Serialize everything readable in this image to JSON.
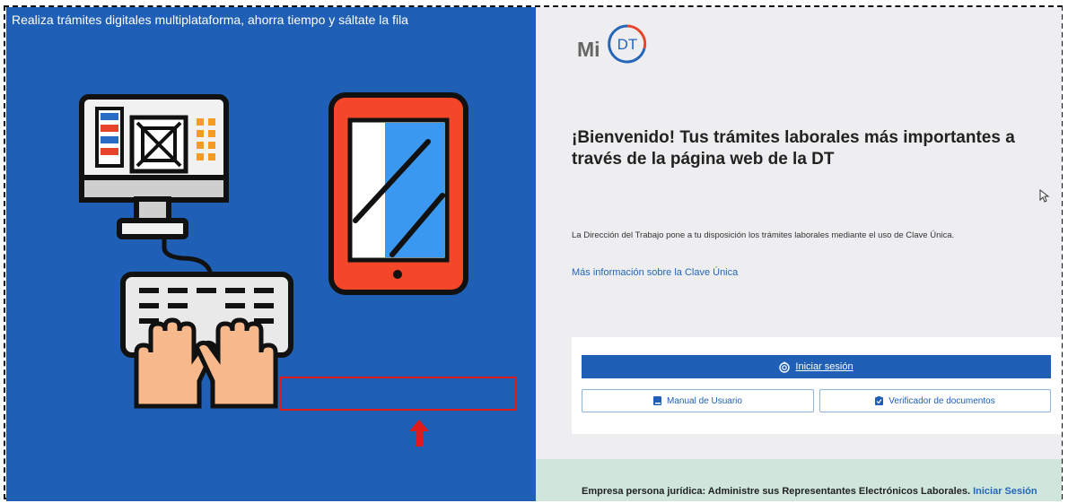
{
  "left_panel": {
    "tagline": "Realiza trámites digitales multiplataforma, ahorra tiempo y sáltate la fila",
    "background": "#1f5fb5"
  },
  "logo": {
    "mi": "Mi",
    "dt": "DT"
  },
  "welcome": {
    "title": "¡Bienvenido! Tus trámites laborales más importantes a través de la página web de la DT"
  },
  "description": "La Dirección del Trabajo pone a tu disposición los trámites laborales mediante el uso de Clave Única.",
  "more_info_link": "Más información sobre la Clave Única",
  "buttons": {
    "login": "Iniciar sesión",
    "manual": "Manual de Usuario",
    "verifier": "Verificador de documentos"
  },
  "footer": {
    "text": "Empresa persona jurídica: Administre sus Representantes Electrónicos Laborales.",
    "link": "Iniciar Sesión"
  },
  "icons": [
    "desktop-computer-icon",
    "keyboard-hands-icon",
    "tablet-icon",
    "fingerprint-icon",
    "book-icon",
    "clipboard-check-icon",
    "red-arrow-up-icon",
    "mouse-cursor-icon"
  ],
  "colors": {
    "primary": "#1f5fb5",
    "highlight": "#e01b1b",
    "footer_bg": "#cfe6dc",
    "tablet": "#f4472a"
  }
}
